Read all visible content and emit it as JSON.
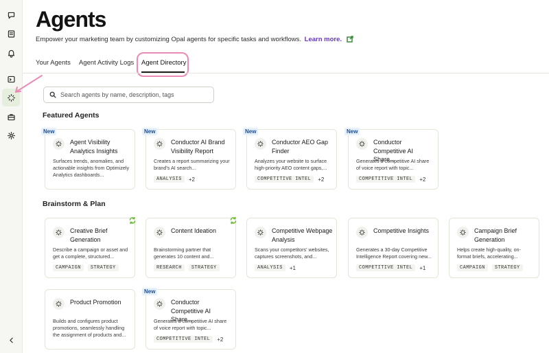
{
  "page": {
    "title": "Agents",
    "subtitle": "Empower your marketing team by customizing Opal agents for specific tasks and workflows.",
    "learn_more": "Learn more."
  },
  "tabs": [
    {
      "label": "Your Agents"
    },
    {
      "label": "Agent Activity Logs"
    },
    {
      "label": "Agent Directory",
      "active": true
    }
  ],
  "search": {
    "placeholder": "Search agents by name, description, tags"
  },
  "sections": {
    "featured": {
      "title": "Featured Agents",
      "cards": [
        {
          "title": "Agent Visibility Analytics Insights",
          "description": "Surfaces trends, anomalies, and actionable insights from Optimizely Analytics dashboards...",
          "tags": [],
          "badge": "New"
        },
        {
          "title": "Conductor AI Brand Visibility Report",
          "description": "Creates a report summarizing your brand's AI search...",
          "tags": [
            "ANALYSIS"
          ],
          "more": "+2",
          "badge": "New"
        },
        {
          "title": "Conductor AEO Gap Finder",
          "description": "Analyzes your website to surface high-priority AEO content gaps,...",
          "tags": [
            "COMPETITIVE INTEL"
          ],
          "more": "+2",
          "badge": "New"
        },
        {
          "title": "Conductor Competitive AI Share...",
          "description": "Generates a competitive AI share of voice report with topic...",
          "tags": [
            "COMPETITIVE INTEL"
          ],
          "more": "+2",
          "badge": "New"
        }
      ]
    },
    "brainstorm": {
      "title": "Brainstorm & Plan",
      "cards": [
        {
          "title": "Creative Brief Generation",
          "description": "Describe a campaign or asset and get a complete, structured...",
          "tags": [
            "CAMPAIGN",
            "STRATEGY"
          ],
          "sync": true
        },
        {
          "title": "Content Ideation",
          "description": "Brainstorming partner that generates 10 content and...",
          "tags": [
            "RESEARCH",
            "STRATEGY"
          ],
          "sync": true
        },
        {
          "title": "Competitive Webpage Analysis",
          "description": "Scans your competitors' websites, captures screenshots, and...",
          "tags": [
            "ANALYSIS"
          ],
          "more": "+1"
        },
        {
          "title": "Competitive Insights",
          "description": "Generates a 30-day Competitive Intelligence Report covering new...",
          "tags": [
            "COMPETITIVE INTEL"
          ],
          "more": "+1"
        },
        {
          "title": "Campaign Brief Generation",
          "description": "Helps create high-quality, on-format briefs, accelerating...",
          "tags": [
            "CAMPAIGN",
            "STRATEGY"
          ]
        },
        {
          "title": "Product Promotion",
          "description": "Builds and configures product promotions, seamlessly handling the assignment of products and...",
          "tags": []
        },
        {
          "title": "Conductor Competitive AI Share...",
          "description": "Generates a competitive AI share of voice report with topic...",
          "tags": [
            "COMPETITIVE INTEL"
          ],
          "more": "+2",
          "badge": "New"
        }
      ]
    }
  },
  "sidebar": {
    "icons": [
      "chat-icon",
      "notes-icon",
      "bell-icon",
      "terminal-icon",
      "agents-icon",
      "briefcase-icon",
      "gear-icon",
      "collapse-chevron-icon"
    ],
    "active": "agents-icon"
  },
  "colors": {
    "accent": "#6a35c9",
    "highlight": "#e98bb5",
    "badge": "#e6f1fb",
    "card_border": "#e1e7d8"
  }
}
